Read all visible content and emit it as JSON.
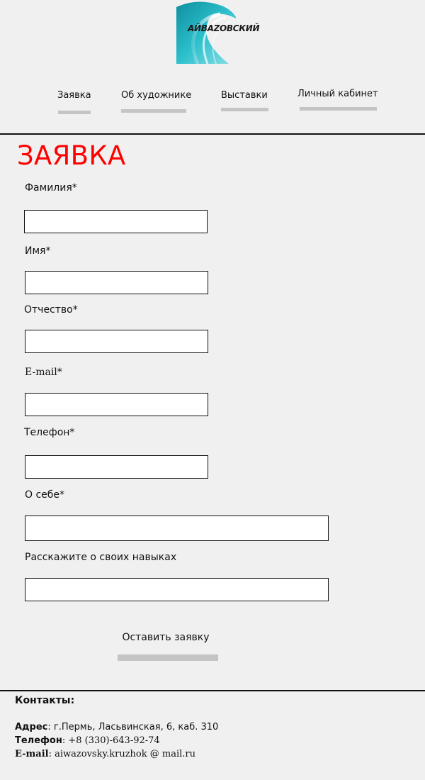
{
  "brand": {
    "logo_text": "АЙВAZОВСКИЙ"
  },
  "nav": {
    "items": [
      {
        "label": "Заявка"
      },
      {
        "label": "Об художнике"
      },
      {
        "label": "Выставки"
      },
      {
        "label": "Личный кабинет"
      }
    ]
  },
  "page": {
    "title": "ЗАЯВКА"
  },
  "form": {
    "fields": [
      {
        "label": "Фамилия*",
        "value": ""
      },
      {
        "label": "Имя*",
        "value": ""
      },
      {
        "label": "Отчество*",
        "value": ""
      },
      {
        "label": "E-mail*",
        "value": ""
      },
      {
        "label": "Телефон*",
        "value": ""
      },
      {
        "label": "О себе*",
        "value": ""
      },
      {
        "label": "Расскажите о своих навыках",
        "value": ""
      }
    ],
    "submit_label": "Оставить заявку"
  },
  "footer": {
    "heading": "Контакты:",
    "address_key": "Адрес",
    "address_value": ": г.Пермь, Ласьвинская, 6, каб. 310",
    "phone_key": "Телефон",
    "phone_value": ": +8 (330)-643-92-74",
    "email_key": "E-mail",
    "email_value": ": aiwazovsky.kruzhok @ mail.ru"
  },
  "colors": {
    "title": "#ff0000",
    "background": "#f0f0f0",
    "nav_underline": "#c4c4c4",
    "logo_teal": "#1fb0bd"
  }
}
